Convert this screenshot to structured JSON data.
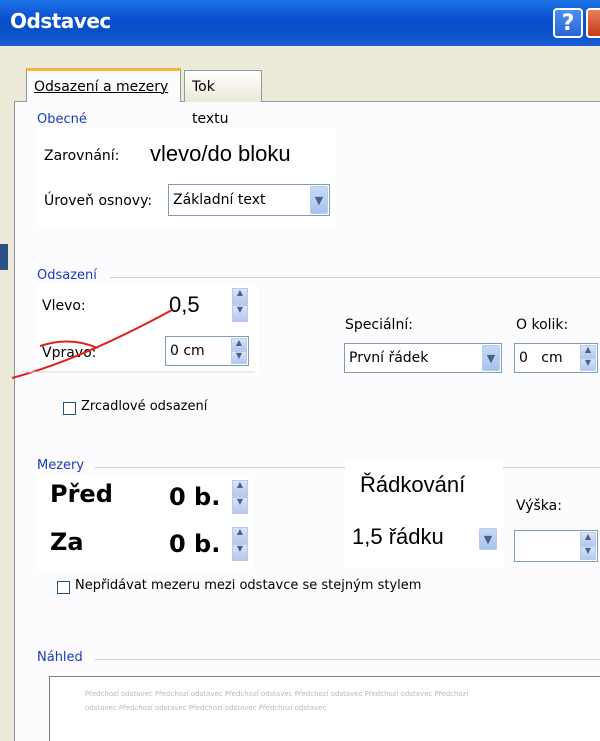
{
  "window": {
    "title": "Odstavec",
    "help_symbol": "?"
  },
  "tabs": [
    {
      "label": "Odsazení a mezery",
      "active": true
    },
    {
      "label": "Tok textu",
      "active": false
    }
  ],
  "general": {
    "group_label": "Obecné",
    "alignment_label": "Zarovnání:",
    "alignment_value": "vlevo/do bloku",
    "outline_label": "Úroveň osnovy:",
    "outline_value": "Základní text"
  },
  "indent": {
    "group_label": "Odsazení",
    "left_label": "Vlevo:",
    "left_value": "0,5",
    "right_label": "Vpravo:",
    "right_value": "0 cm",
    "special_label": "Speciální:",
    "special_value": "První řádek",
    "by_label": "O kolik:",
    "by_value": "0   cm",
    "mirror_label": "Zrcadlové odsazení",
    "mirror_checked": false
  },
  "spacing": {
    "group_label": "Mezery",
    "before_label": "Před",
    "before_value": "0 b.",
    "after_label": "Za",
    "after_value": "0 b.",
    "line_spacing_label": "Řádkování",
    "line_spacing_value": "1,5 řádku",
    "height_label": "Výška:",
    "height_value": "",
    "no_space_label": "Nepřidávat mezeru mezi odstavce se stejným stylem",
    "no_space_checked": false
  },
  "preview": {
    "group_label": "Náhled",
    "line1": "Předchozí odstavec Předchozí odstavec Předchozí odstavec Předchozí odstavec Předchozí odstavec Předchozí",
    "line2": "odstavec Předchozí odstavec Předchozí odstavec Předchozí odstavec"
  },
  "colors": {
    "titlebar": "#0a4fd0",
    "group_label": "#1a3db7",
    "active_tab_accent": "#f7b33e",
    "annotation_red": "#e02020"
  }
}
